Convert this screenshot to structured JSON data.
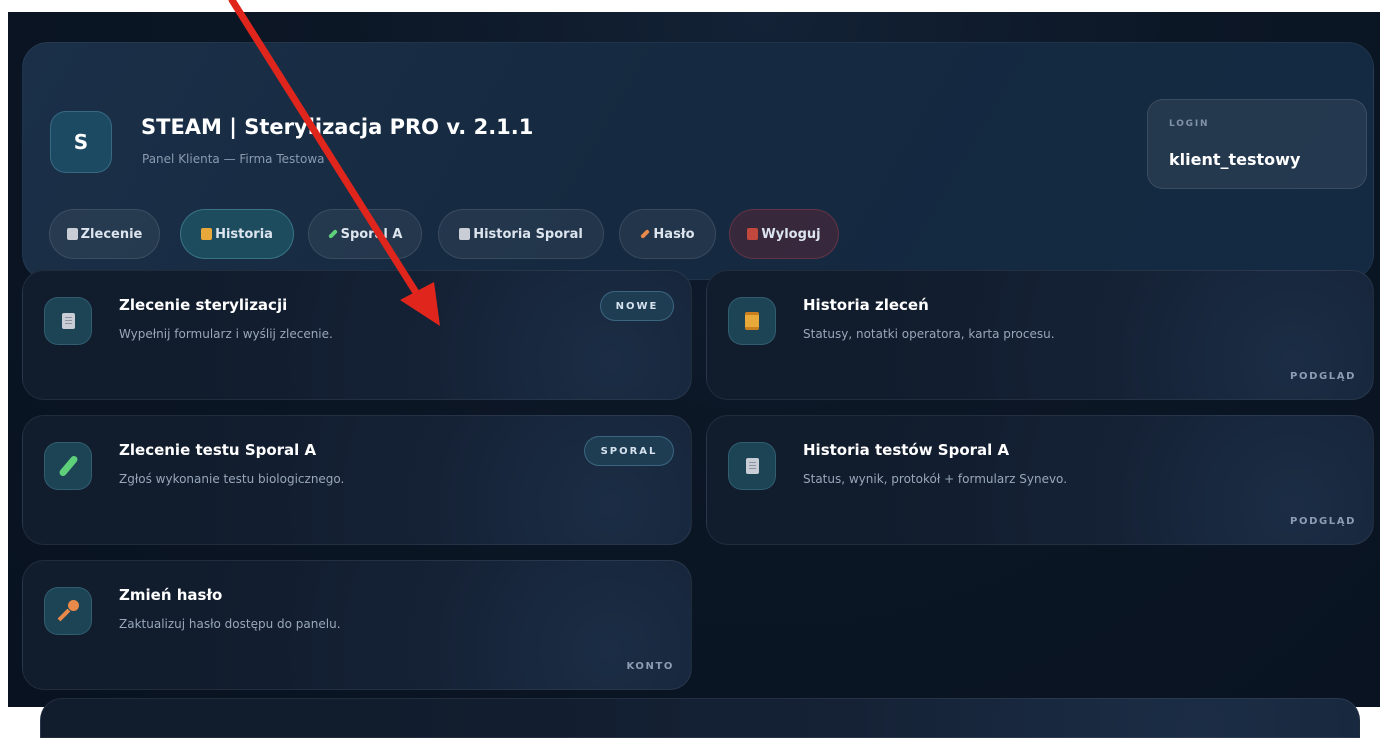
{
  "header": {
    "avatar_letter": "S",
    "title": "STEAM | Sterylizacja PRO v. 2.1.1",
    "subtitle": "Panel Klienta — Firma Testowa",
    "login_label": "LOGIN",
    "login_user": "klient_testowy"
  },
  "nav": [
    {
      "label": "Zlecenie",
      "icon": "document-icon"
    },
    {
      "label": "Historia",
      "icon": "scroll-icon"
    },
    {
      "label": "Sporal A",
      "icon": "test-tube-icon"
    },
    {
      "label": "Historia Sporal",
      "icon": "document-icon"
    },
    {
      "label": "Hasło",
      "icon": "key-icon"
    },
    {
      "label": "Wyloguj",
      "icon": "door-icon"
    }
  ],
  "cards": [
    {
      "title": "Zlecenie sterylizacji",
      "desc": "Wypełnij formularz i wyślij zlecenie.",
      "badge": "NOWE",
      "icon": "document-icon"
    },
    {
      "title": "Historia zleceń",
      "desc": "Statusy, notatki operatora, karta procesu.",
      "tag": "PODGLĄD",
      "icon": "scroll-icon"
    },
    {
      "title": "Zlecenie testu Sporal A",
      "desc": "Zgłoś wykonanie testu biologicznego.",
      "badge": "SPORAL",
      "icon": "test-tube-icon"
    },
    {
      "title": "Historia testów Sporal A",
      "desc": "Status, wynik, protokół + formularz Synevo.",
      "tag": "PODGLĄD",
      "icon": "document-icon"
    },
    {
      "title": "Zmień hasło",
      "desc": "Zaktualizuj hasło dostępu do panelu.",
      "tag": "KONTO",
      "icon": "key-icon"
    }
  ],
  "colors": {
    "annotation_arrow": "#e0261c",
    "accent_active": "#1d4c5e",
    "background": "#0c1726"
  }
}
